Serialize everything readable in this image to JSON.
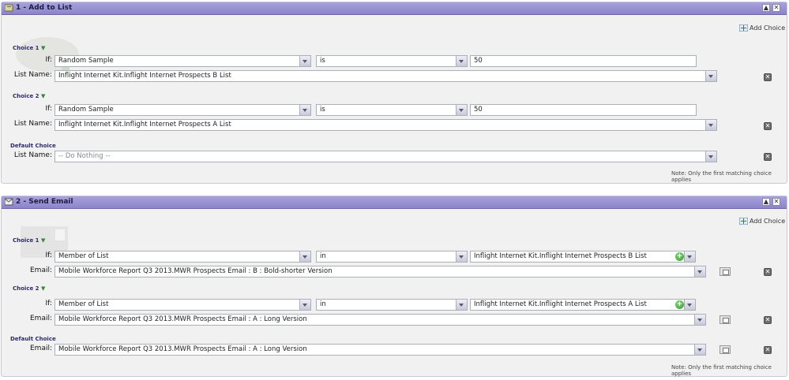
{
  "panel1": {
    "title": "1 - Add to List",
    "add_choice": "Add Choice",
    "choices": [
      {
        "label": "Choice 1",
        "if_label": "If:",
        "field": "Random Sample",
        "operator": "is",
        "value": "50",
        "target_label": "List Name:",
        "target": "Inflight Internet Kit.Inflight Internet Prospects B List"
      },
      {
        "label": "Choice 2",
        "if_label": "If:",
        "field": "Random Sample",
        "operator": "is",
        "value": "50",
        "target_label": "List Name:",
        "target": "Inflight Internet Kit.Inflight Internet Prospects A List"
      }
    ],
    "default": {
      "label": "Default Choice",
      "target_label": "List Name:",
      "target": "-- Do Nothing --"
    },
    "note": "Note: Only the first matching choice applies"
  },
  "panel2": {
    "title": "2 - Send Email",
    "add_choice": "Add Choice",
    "choices": [
      {
        "label": "Choice 1",
        "if_label": "If:",
        "field": "Member of List",
        "operator": "in",
        "value": "Inflight Internet Kit.Inflight Internet Prospects B List",
        "target_label": "Email:",
        "target": "Mobile Workforce Report Q3 2013.MWR Prospects Email : B : Bold-shorter Version"
      },
      {
        "label": "Choice 2",
        "if_label": "If:",
        "field": "Member of List",
        "operator": "in",
        "value": "Inflight Internet Kit.Inflight Internet Prospects A List",
        "target_label": "Email:",
        "target": "Mobile Workforce Report Q3 2013.MWR Prospects Email : A : Long Version"
      }
    ],
    "default": {
      "label": "Default Choice",
      "target_label": "Email:",
      "target": "Mobile Workforce Report Q3 2013.MWR Prospects Email : A : Long Version"
    },
    "note": "Note: Only the first matching choice applies"
  },
  "icons": {
    "collapse": "collapse-icon",
    "close": "close-icon",
    "delete": "delete-icon",
    "preview": "preview-icon",
    "add": "add-icon",
    "expand_choice": "triangle-down-icon"
  },
  "colors": {
    "header": "#8b84c8",
    "label": "#2c2c68",
    "add": "#2f9a2a"
  }
}
